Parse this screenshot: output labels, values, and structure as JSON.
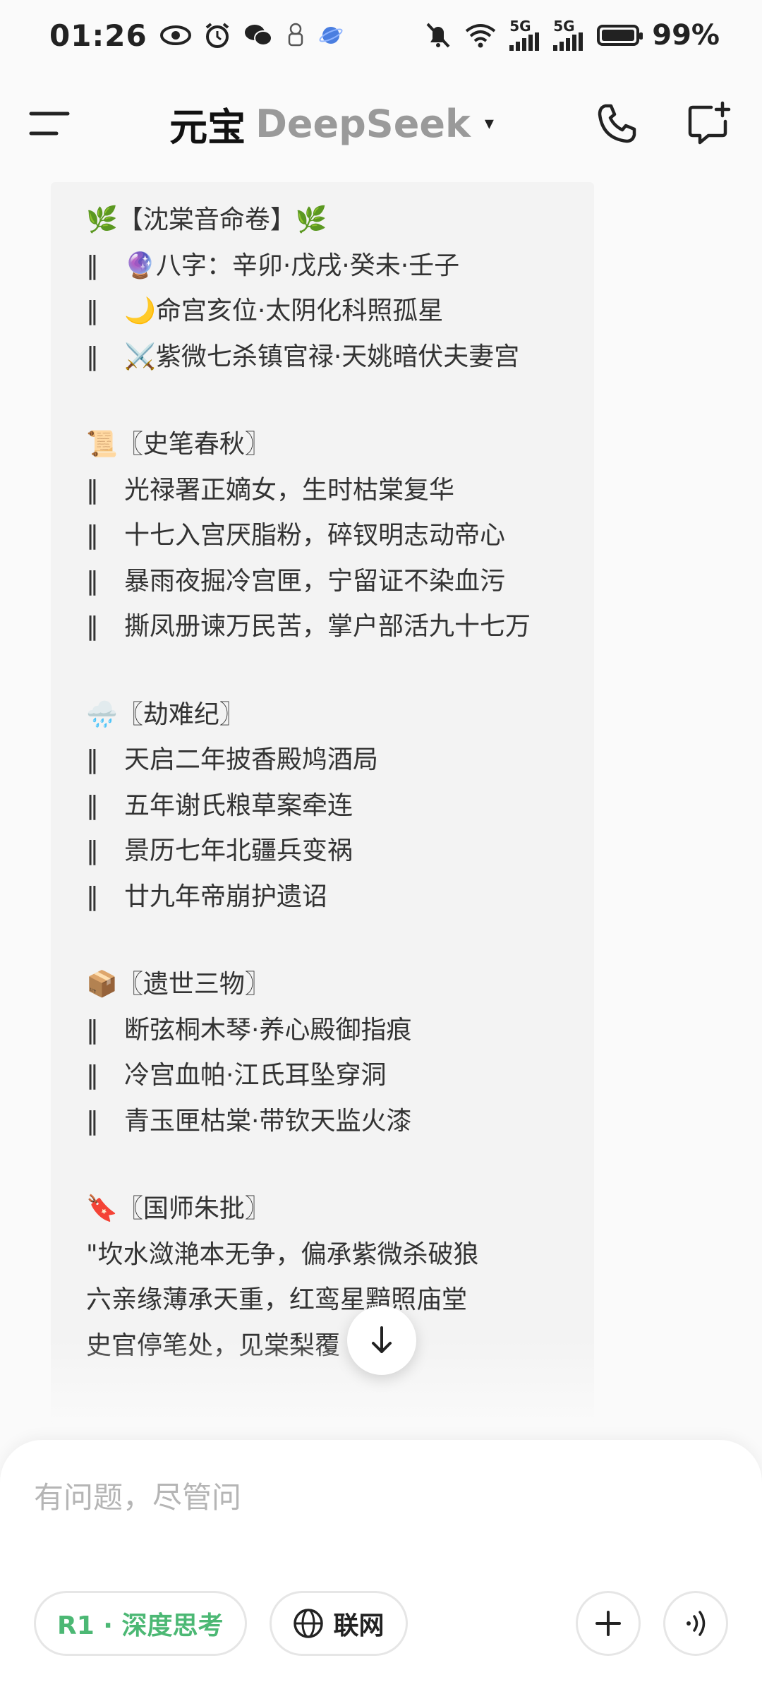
{
  "status_bar": {
    "time": "01:26",
    "battery_text": "99%",
    "network_label_1": "5G",
    "network_label_2": "5G"
  },
  "header": {
    "brand_primary": "元宝",
    "brand_secondary": "DeepSeek",
    "caret": "▾"
  },
  "content": {
    "blocks": [
      {
        "lines": [
          "🌿【沈棠音命卷】🌿",
          "‖　🔮八字：辛卯·戊戌·癸未·壬子",
          "‖　🌙命宫亥位·太阴化科照孤星",
          "‖　⚔️紫微七杀镇官禄·天姚暗伏夫妻宫"
        ]
      },
      {
        "lines": [
          "📜〖史笔春秋〗",
          "‖　光禄署正嫡女，生时枯棠复华",
          "‖　十七入宫厌脂粉，碎钗明志动帝心",
          "‖　暴雨夜掘冷宫匣，宁留证不染血污",
          "‖　撕凤册谏万民苦，掌户部活九十七万"
        ]
      },
      {
        "lines": [
          "🌧️〖劫难纪〗",
          "‖　天启二年披香殿鸠酒局",
          "‖　五年谢氏粮草案牵连",
          "‖　景历七年北疆兵变祸",
          "‖　廿九年帝崩护遗诏"
        ]
      },
      {
        "lines": [
          "📦〖遗世三物〗",
          "‖　断弦桐木琴·养心殿御指痕",
          "‖　冷宫血帕·江氏耳坠穿洞",
          "‖　青玉匣枯棠·带钦天监火漆"
        ]
      },
      {
        "lines": [
          "🔖〖国师朱批〗",
          "\"坎水潋滟本无争，偏承紫微杀破狼",
          "六亲缘薄承天重，红鸾星黯照庙堂",
          "史官停笔处，见棠梨覆"
        ]
      }
    ]
  },
  "composer": {
    "placeholder": "有问题，尽管问",
    "chip_r1": "R1 · 深度思考",
    "chip_web": "联网"
  },
  "colors": {
    "accent_green": "#4cb874",
    "content_bg": "#f3f3f3",
    "placeholder": "#b5b5b5"
  }
}
